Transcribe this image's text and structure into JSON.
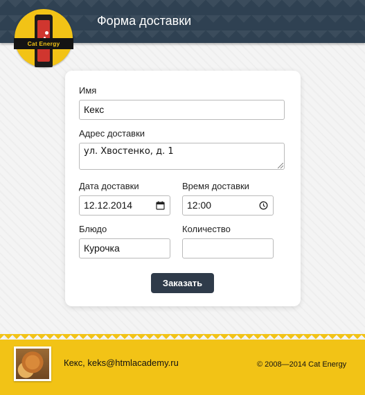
{
  "header": {
    "title": "Форма доставки",
    "logo_text": "Cat Energy"
  },
  "form": {
    "name_label": "Имя",
    "name_value": "Кекс",
    "address_label": "Адрес доставки",
    "address_value": "ул. Хвостенко, д. 1",
    "date_label": "Дата доставки",
    "date_value": "12.12.2014",
    "time_label": "Время доставки",
    "time_value": "12:00",
    "dish_label": "Блюдо",
    "dish_value": "Курочка",
    "quantity_label": "Количество",
    "quantity_value": "",
    "submit_label": "Заказать"
  },
  "footer": {
    "contact": "Кекс, keks@htmlacademy.ru",
    "copyright": "© 2008—2014 Cat Energy"
  },
  "colors": {
    "header_bg": "#2f4152",
    "accent_yellow": "#f2c316",
    "button_bg": "#2f3b4a"
  }
}
